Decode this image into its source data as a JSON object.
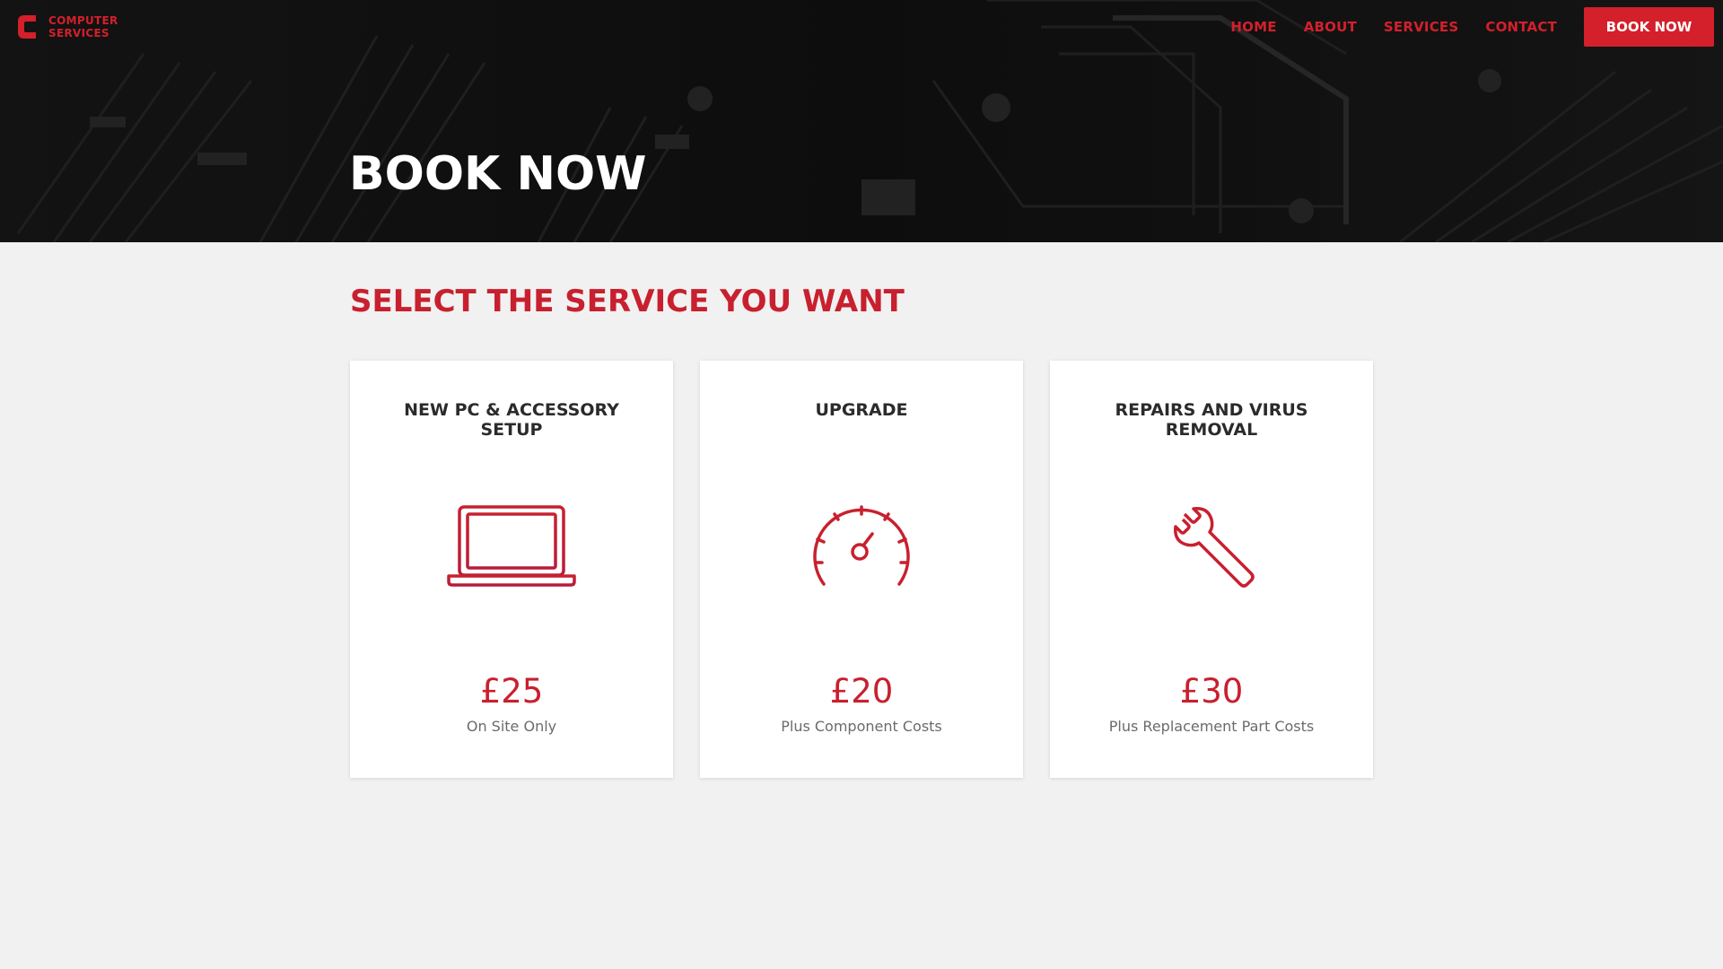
{
  "brand": {
    "line1": "COMPUTER",
    "line2": "SERVICES",
    "accent_color": "#d3202b",
    "logo_icon": "c-logo-icon"
  },
  "nav": {
    "items": [
      {
        "label": "HOME"
      },
      {
        "label": "ABOUT"
      },
      {
        "label": "SERVICES"
      },
      {
        "label": "CONTACT"
      }
    ],
    "cta_label": "BOOK NOW"
  },
  "hero": {
    "title": "BOOK NOW",
    "background": "dark motherboard photo"
  },
  "main": {
    "section_title": "SELECT THE SERVICE YOU WANT",
    "cards": [
      {
        "title": "NEW PC & ACCESSORY SETUP",
        "icon": "laptop-icon",
        "price": "£25",
        "note": "On Site Only"
      },
      {
        "title": "UPGRADE",
        "icon": "speedometer-icon",
        "price": "£20",
        "note": "Plus Component Costs"
      },
      {
        "title": "REPAIRS AND VIRUS REMOVAL",
        "icon": "wrench-icon",
        "price": "£30",
        "note": "Plus Replacement Part Costs"
      }
    ]
  },
  "colors": {
    "accent": "#d3202b",
    "page_background": "#f1f1f1",
    "hero_background": "#121212",
    "card_background": "#ffffff"
  }
}
